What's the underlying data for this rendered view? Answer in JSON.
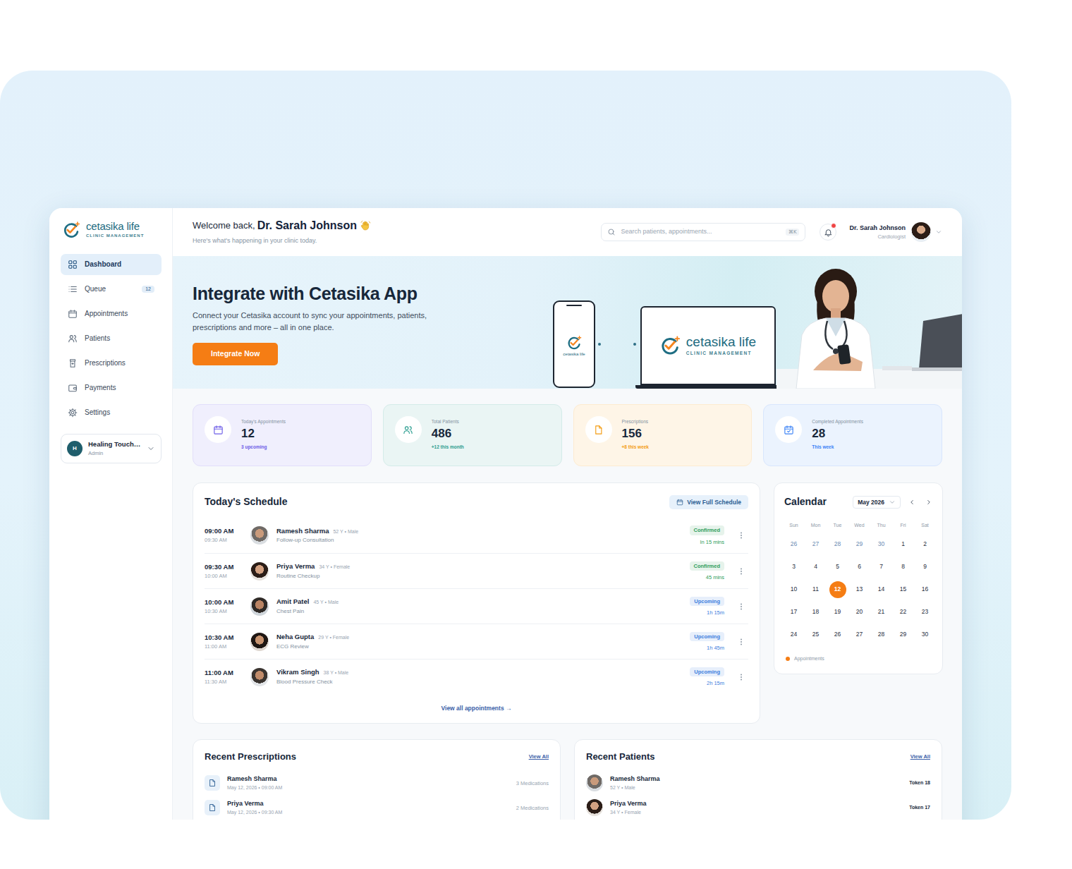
{
  "brand": {
    "name": "cetasika life",
    "tagline": "CLINIC MANAGEMENT"
  },
  "sidebar": {
    "items": [
      {
        "label": "Dashboard",
        "selected": true
      },
      {
        "label": "Queue",
        "selected": false,
        "badge": "12"
      },
      {
        "label": "Appointments",
        "selected": false
      },
      {
        "label": "Patients",
        "selected": false
      },
      {
        "label": "Prescriptions",
        "selected": false
      },
      {
        "label": "Payments",
        "selected": false
      },
      {
        "label": "Settings",
        "selected": false
      }
    ],
    "clinic": {
      "initial": "H",
      "name": "Healing Touch…",
      "role": "Admin"
    }
  },
  "header": {
    "greeting": "Welcome back,",
    "name": "Dr. Sarah Johnson",
    "subtitle": "Here's what's happening in your clinic today."
  },
  "search": {
    "placeholder": "Search patients, appointments...",
    "shortcut": "⌘K"
  },
  "notifications": {
    "unread": true
  },
  "user": {
    "name": "Dr. Sarah Johnson",
    "role": "Cardiologist"
  },
  "banner": {
    "title": "Integrate with Cetasika App",
    "text": "Connect your Cetasika account to sync your appointments, patients, prescriptions and more – all in one place.",
    "button": "Integrate Now",
    "phone_label": "cetasika life",
    "laptop_name": "cetasika life",
    "laptop_tagline": "CLINIC MANAGEMENT"
  },
  "stats": [
    {
      "label": "Today's Appointments",
      "value": "12",
      "note": "3 upcoming",
      "color": "#6c5ce7"
    },
    {
      "label": "Total Patients",
      "value": "486",
      "note": "+12 this month",
      "color": "#2a9d8f"
    },
    {
      "label": "Prescriptions",
      "value": "156",
      "note": "+8 this week",
      "color": "#f39c12"
    },
    {
      "label": "Completed Appointments",
      "value": "28",
      "note": "This week",
      "color": "#3b82f6"
    }
  ],
  "schedule": {
    "title": "Today's Schedule",
    "button": "View Full Schedule",
    "rows": [
      {
        "time": "09:00 AM",
        "end": "09:30 AM",
        "name": "Ramesh Sharma",
        "meta": "52 Y • Male",
        "reason": "Follow-up Consultation",
        "status": "Confirmed",
        "eta": "In 15 mins",
        "color": "#2f9e5b"
      },
      {
        "time": "09:30 AM",
        "end": "10:00 AM",
        "name": "Priya Verma",
        "meta": "34 Y • Female",
        "reason": "Routine Checkup",
        "status": "Confirmed",
        "eta": "45 mins",
        "color": "#2f9e5b"
      },
      {
        "time": "10:00 AM",
        "end": "10:30 AM",
        "name": "Amit Patel",
        "meta": "45 Y • Male",
        "reason": "Chest Pain",
        "status": "Upcoming",
        "eta": "1h 15m",
        "color": "#3b7ddd"
      },
      {
        "time": "10:30 AM",
        "end": "11:00 AM",
        "name": "Neha Gupta",
        "meta": "29 Y • Female",
        "reason": "ECG Review",
        "status": "Upcoming",
        "eta": "1h 45m",
        "color": "#3b7ddd"
      },
      {
        "time": "11:00 AM",
        "end": "11:30 AM",
        "name": "Vikram Singh",
        "meta": "38 Y • Male",
        "reason": "Blood Pressure Check",
        "status": "Upcoming",
        "eta": "2h 15m",
        "color": "#3b7ddd"
      }
    ],
    "footer": "View all appointments →"
  },
  "calendar": {
    "title": "Calendar",
    "month": "May 2026",
    "weekdays": [
      "Sun",
      "Mon",
      "Tue",
      "Wed",
      "Thu",
      "Fri",
      "Sat"
    ],
    "days": [
      {
        "d": "26",
        "muted": true,
        "selected": false
      },
      {
        "d": "27",
        "muted": true,
        "selected": false
      },
      {
        "d": "28",
        "muted": true,
        "selected": false
      },
      {
        "d": "29",
        "muted": true,
        "selected": false
      },
      {
        "d": "30",
        "muted": true,
        "selected": false
      },
      {
        "d": "1",
        "muted": false,
        "selected": false
      },
      {
        "d": "2",
        "muted": false,
        "selected": false
      },
      {
        "d": "3",
        "muted": false,
        "selected": false
      },
      {
        "d": "4",
        "muted": false,
        "selected": false
      },
      {
        "d": "5",
        "muted": false,
        "selected": false
      },
      {
        "d": "6",
        "muted": false,
        "selected": false
      },
      {
        "d": "7",
        "muted": false,
        "selected": false
      },
      {
        "d": "8",
        "muted": false,
        "selected": false
      },
      {
        "d": "9",
        "muted": false,
        "selected": false
      },
      {
        "d": "10",
        "muted": false,
        "selected": false
      },
      {
        "d": "11",
        "muted": false,
        "selected": false
      },
      {
        "d": "12",
        "muted": false,
        "selected": true
      },
      {
        "d": "13",
        "muted": false,
        "selected": false
      },
      {
        "d": "14",
        "muted": false,
        "selected": false
      },
      {
        "d": "15",
        "muted": false,
        "selected": false
      },
      {
        "d": "16",
        "muted": false,
        "selected": false
      },
      {
        "d": "17",
        "muted": false,
        "selected": false
      },
      {
        "d": "18",
        "muted": false,
        "selected": false
      },
      {
        "d": "19",
        "muted": false,
        "selected": false
      },
      {
        "d": "20",
        "muted": false,
        "selected": false
      },
      {
        "d": "21",
        "muted": false,
        "selected": false
      },
      {
        "d": "22",
        "muted": false,
        "selected": false
      },
      {
        "d": "23",
        "muted": false,
        "selected": false
      },
      {
        "d": "24",
        "muted": false,
        "selected": false
      },
      {
        "d": "25",
        "muted": false,
        "selected": false
      },
      {
        "d": "26",
        "muted": false,
        "selected": false
      },
      {
        "d": "27",
        "muted": false,
        "selected": false
      },
      {
        "d": "28",
        "muted": false,
        "selected": false
      },
      {
        "d": "29",
        "muted": false,
        "selected": false
      },
      {
        "d": "30",
        "muted": false,
        "selected": false
      }
    ],
    "legend": "Appointments"
  },
  "prescriptions": {
    "title": "Recent Prescriptions",
    "view_all": "View All",
    "items": [
      {
        "name": "Ramesh Sharma",
        "date": "May 12, 2026 • 09:00 AM",
        "count": "3 Medications"
      },
      {
        "name": "Priya Verma",
        "date": "May 12, 2026 • 09:30 AM",
        "count": "2 Medications"
      }
    ]
  },
  "patients": {
    "title": "Recent Patients",
    "view_all": "View All",
    "items": [
      {
        "name": "Ramesh Sharma",
        "meta": "52 Y • Male",
        "token": "Token 18"
      },
      {
        "name": "Priya Verma",
        "meta": "34 Y • Female",
        "token": "Token 17"
      }
    ]
  }
}
